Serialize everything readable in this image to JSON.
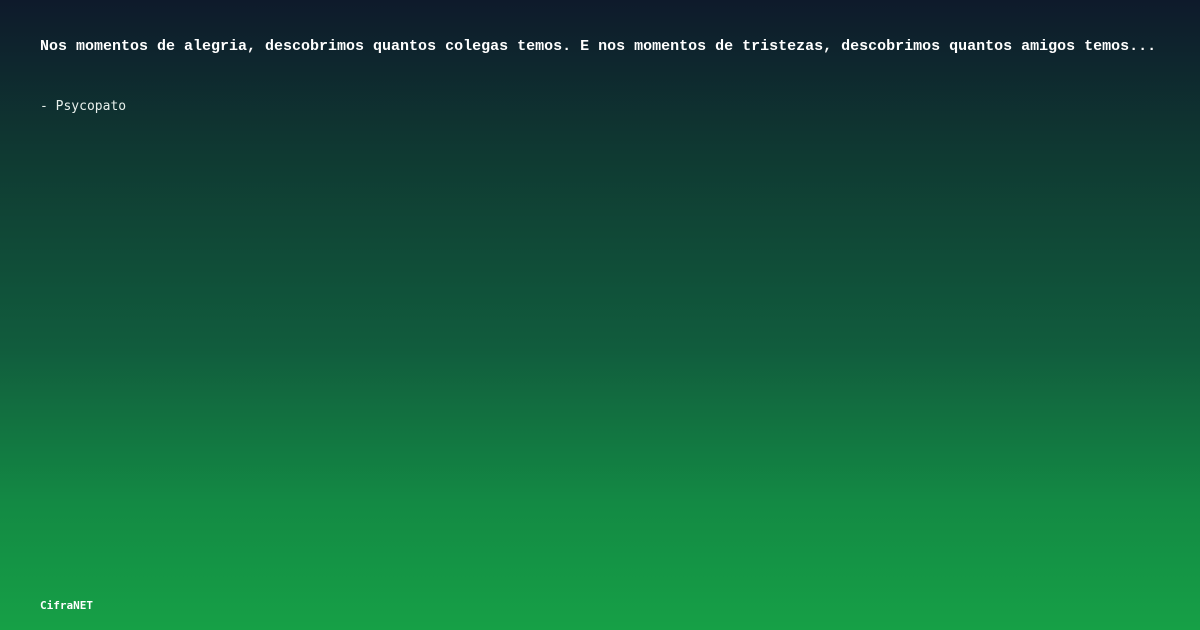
{
  "quote": {
    "text": "Nos momentos de alegria, descobrimos quantos colegas temos. E nos momentos de tristezas, descobrimos quantos amigos temos...",
    "author": "- Psycopato"
  },
  "brand": {
    "name": "CifraNET"
  },
  "colors": {
    "background_top": "#0e1a2b",
    "background_bottom": "#16a046",
    "text": "#ffffff"
  }
}
